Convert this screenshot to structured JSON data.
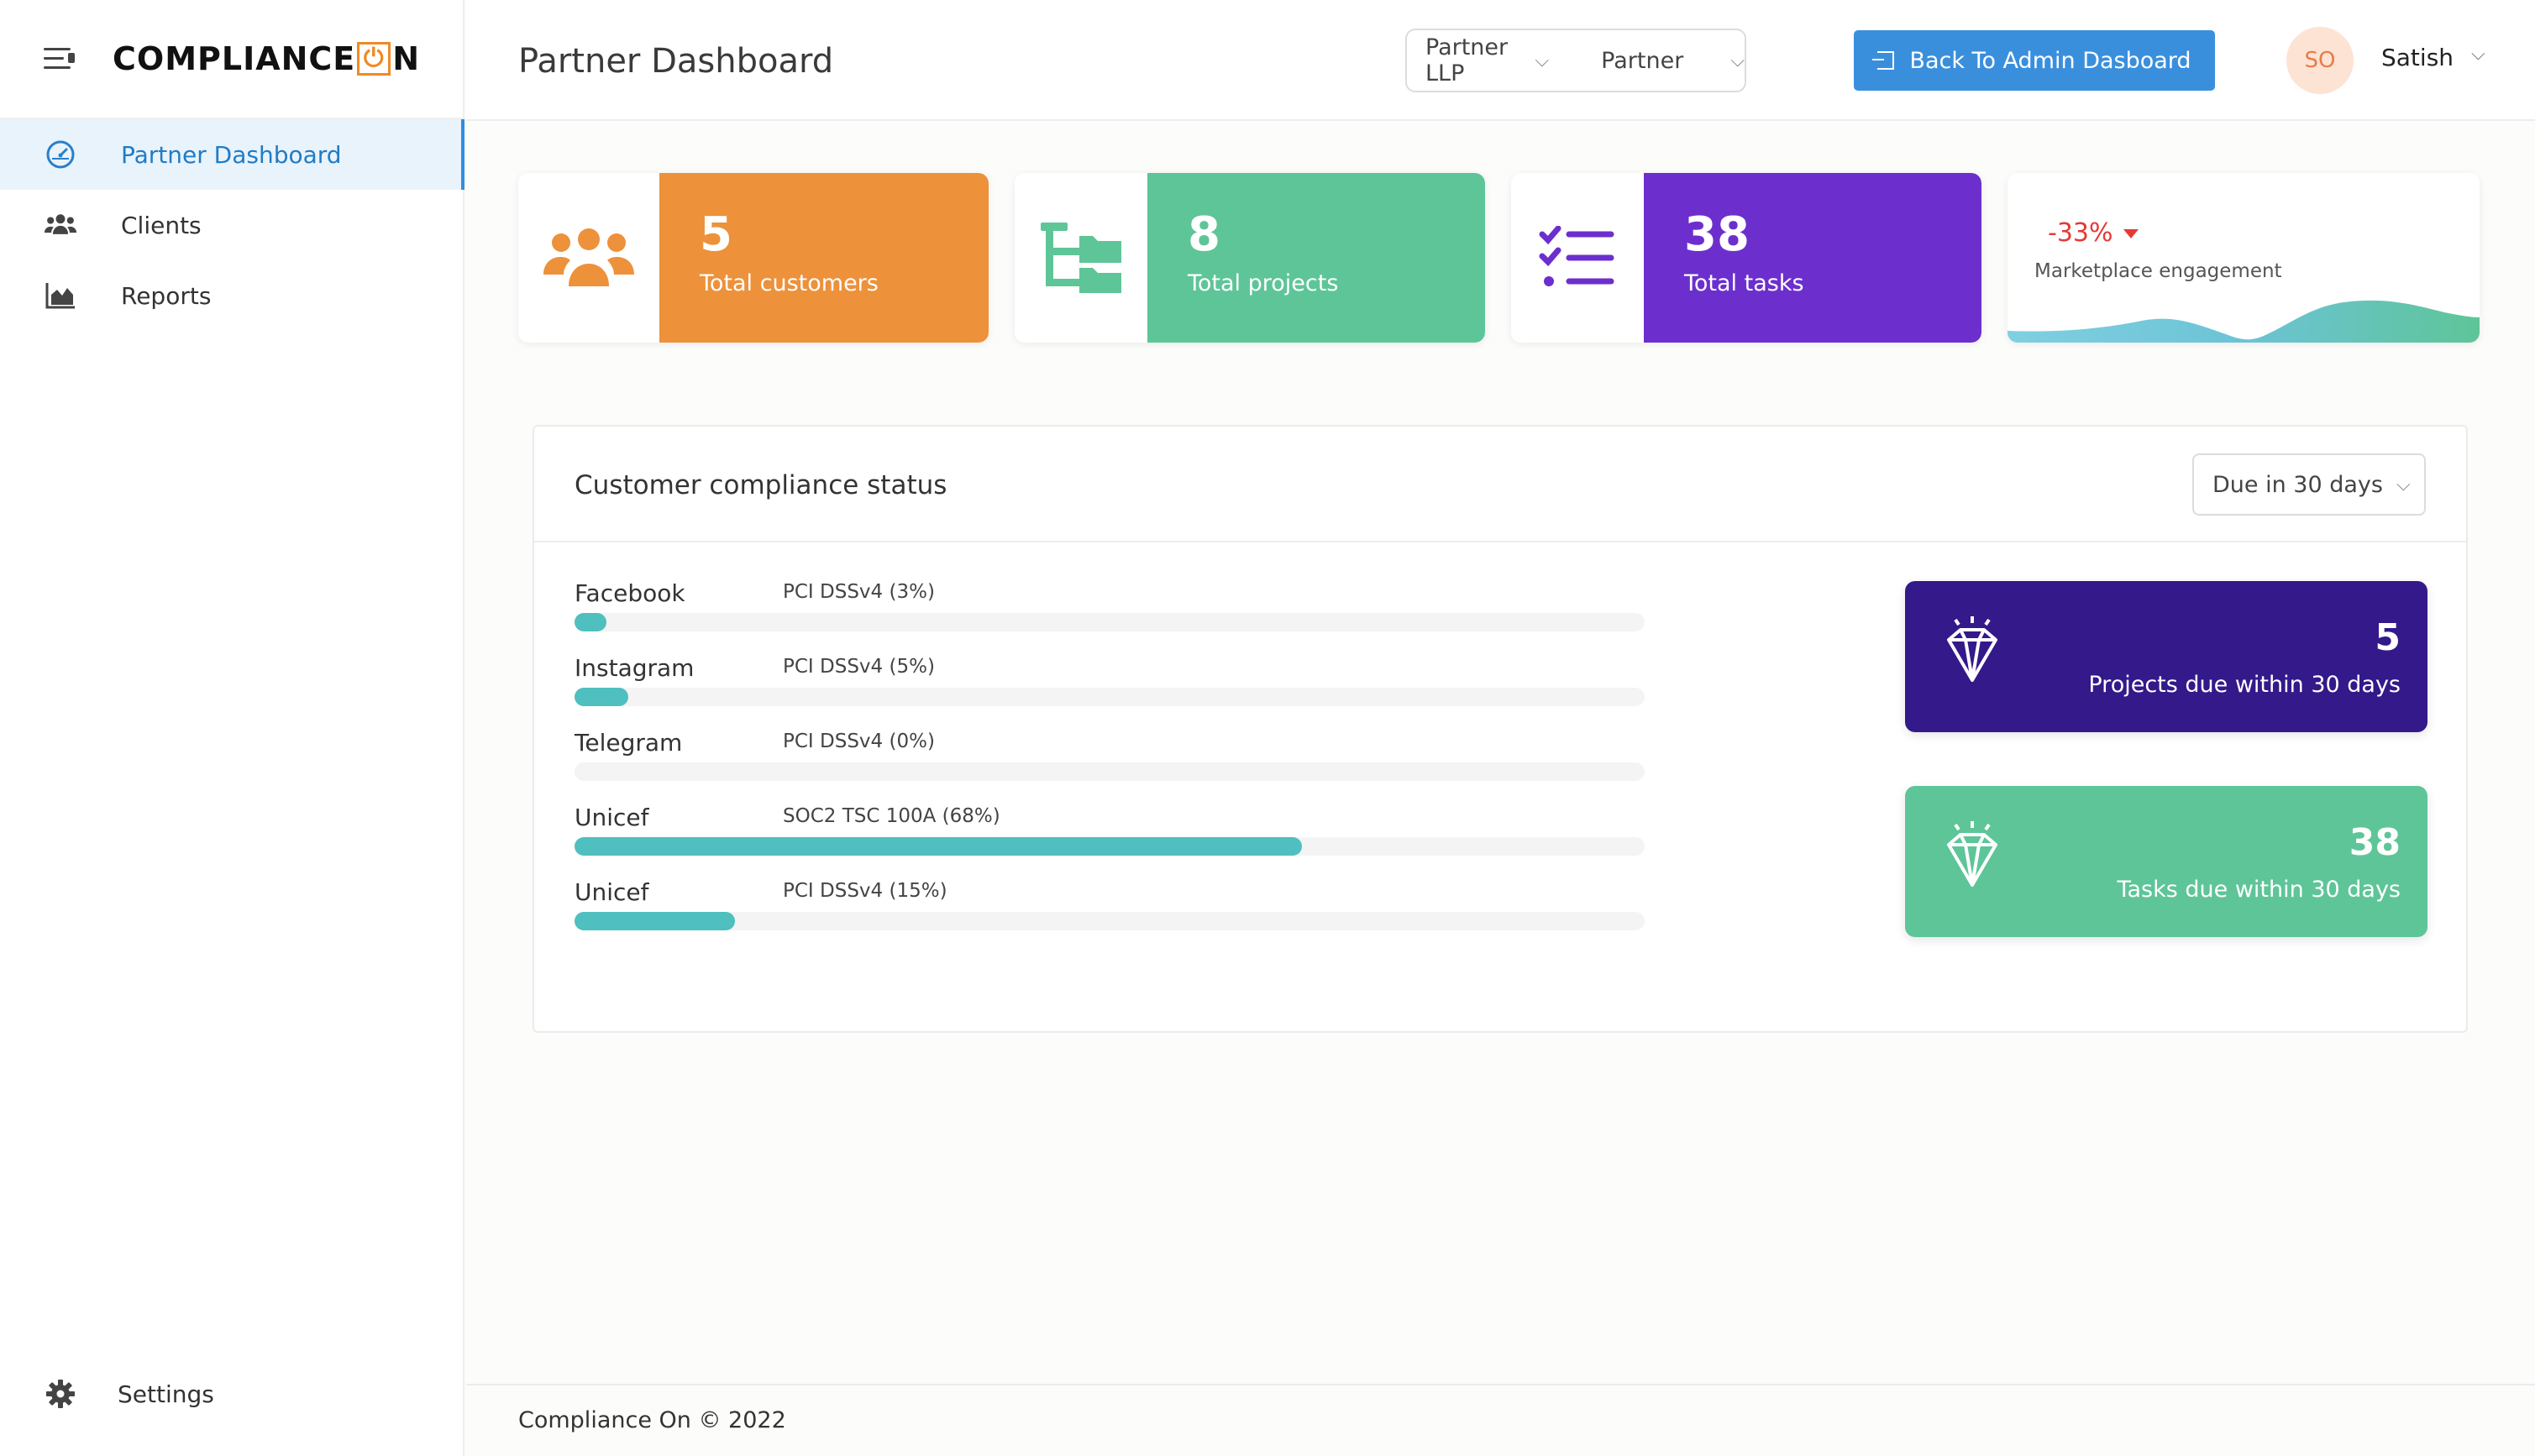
{
  "brand": {
    "logo_text_a": "COMPLIANCE",
    "logo_power": "⏻",
    "logo_text_b": "N"
  },
  "sidebar": {
    "items": [
      {
        "label": "Partner Dashboard",
        "icon": "speedometer-icon",
        "active": true
      },
      {
        "label": "Clients",
        "icon": "users-icon",
        "active": false
      },
      {
        "label": "Reports",
        "icon": "area-chart-icon",
        "active": false
      }
    ],
    "settings_label": "Settings"
  },
  "header": {
    "title": "Partner Dashboard",
    "org_select": "Partner LLP",
    "role_select": "Partner",
    "back_button": "Back To Admin Dasboard",
    "avatar_initials": "SO",
    "user_name": "Satish"
  },
  "stats": [
    {
      "value": "5",
      "label": "Total customers",
      "color": "#ed913b",
      "icon": "customers-icon"
    },
    {
      "value": "8",
      "label": "Total projects",
      "color": "#5ec598",
      "icon": "folder-tree-icon"
    },
    {
      "value": "38",
      "label": "Total tasks",
      "color": "#6c2fcd",
      "icon": "task-list-icon"
    }
  ],
  "engagement": {
    "change": "-33%",
    "label": "Marketplace engagement",
    "change_color": "#e53935"
  },
  "compliance": {
    "title": "Customer compliance status",
    "filter": "Due in 30 days",
    "rows": [
      {
        "customer": "Facebook",
        "framework": "PCI DSSv4 (3%)",
        "progress": 3
      },
      {
        "customer": "Instagram",
        "framework": "PCI DSSv4 (5%)",
        "progress": 5
      },
      {
        "customer": "Telegram",
        "framework": "PCI DSSv4 (0%)",
        "progress": 0
      },
      {
        "customer": "Unicef",
        "framework": "SOC2 TSC 100A (68%)",
        "progress": 68
      },
      {
        "customer": "Unicef",
        "framework": "PCI DSSv4 (15%)",
        "progress": 15
      }
    ],
    "bar_color": "#4fbfbf",
    "due_cards": [
      {
        "value": "5",
        "label": "Projects due within 30 days",
        "color": "#34198a",
        "icon": "diamond-icon"
      },
      {
        "value": "38",
        "label": "Tasks due within 30 days",
        "color": "#5ec598",
        "icon": "diamond-icon"
      }
    ]
  },
  "footer": {
    "text": "Compliance On © 2022"
  }
}
